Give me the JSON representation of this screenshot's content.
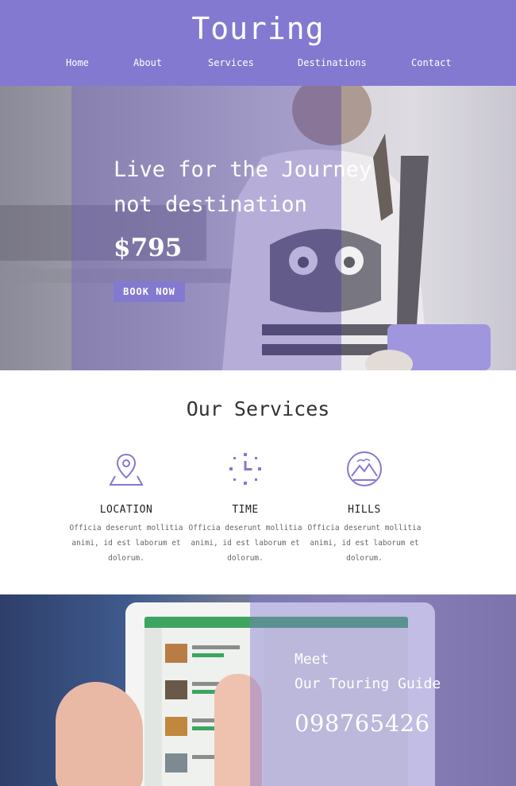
{
  "header": {
    "logo": "Touring",
    "nav": [
      "Home",
      "About",
      "Services",
      "Destinations",
      "Contact"
    ],
    "background_color": "#8379d0"
  },
  "hero": {
    "title_line1": "Live for the Journey",
    "title_line2": "not destination",
    "price": "$795",
    "button_label": "BOOK NOW"
  },
  "services": {
    "title": "Our Services",
    "items": [
      {
        "icon": "map-pin-icon",
        "name": "LOCATION",
        "desc_line1": "Officia deserunt mollitia",
        "desc_line2": "animi, id est laborum et",
        "desc_line3": "dolorum."
      },
      {
        "icon": "clock-icon",
        "name": "TIME",
        "desc_line1": "Officia deserunt mollitia",
        "desc_line2": "animi, id est laborum et",
        "desc_line3": "dolorum."
      },
      {
        "icon": "mountain-icon",
        "name": "HILLS",
        "desc_line1": "Officia deserunt mollitia",
        "desc_line2": "animi, id est laborum et",
        "desc_line3": "dolorum."
      }
    ],
    "icon_color": "#8379d0"
  },
  "guide": {
    "line1": "Meet",
    "line2": "Our Touring Guide",
    "phone": "098765426"
  }
}
